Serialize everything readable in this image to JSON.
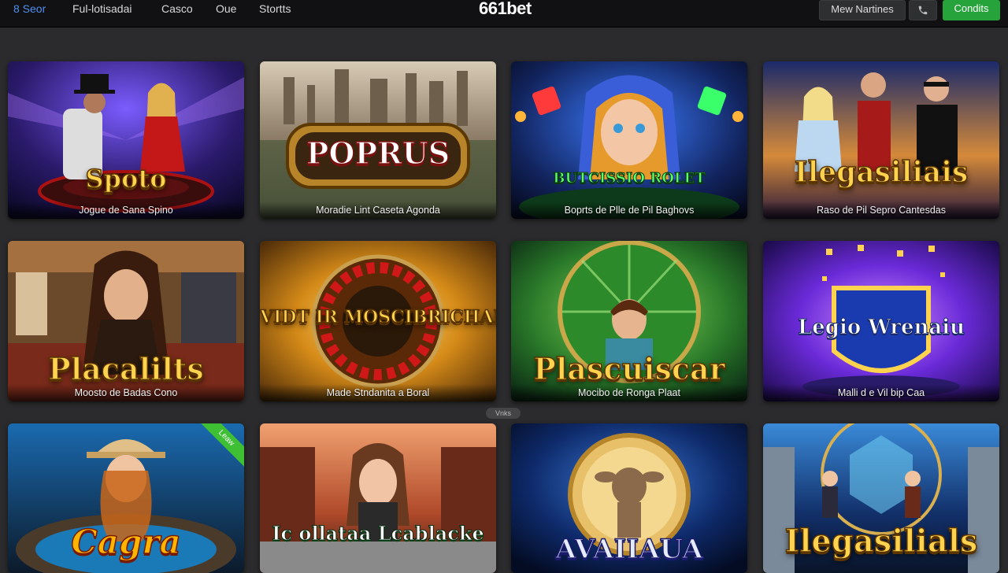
{
  "header": {
    "nav": [
      {
        "label": "8 Seor"
      },
      {
        "label": "Ful-lotisadai"
      },
      {
        "label": "Casco"
      },
      {
        "label": "Oue"
      },
      {
        "label": "Stortts"
      }
    ],
    "logo": "661bet",
    "news_button": "Mew Nartines",
    "phone_icon": "phone-icon",
    "conditions_button": "Condits"
  },
  "games": [
    {
      "title": "Spoto",
      "subtitle": "Jogue de Sana Spino"
    },
    {
      "title": "POPRUS",
      "subtitle": "Moradie Lint Caseta Agonda"
    },
    {
      "title": "BUTCISSIO ROLET",
      "subtitle": "Boprts de Plle de Pil Baghovs"
    },
    {
      "title": "Ilegasiliais",
      "subtitle": "Raso de Pil Sepro Cantesdas"
    },
    {
      "title": "Placalilts",
      "subtitle": "Moosto de Badas Cono"
    },
    {
      "title": "VIDT IR MOSCIBRICHAR",
      "subtitle": "Made Stndanita a Boral"
    },
    {
      "title": "Plascuiscar",
      "subtitle": "Mocibo de Ronga Plaat"
    },
    {
      "title": "Legio Wrenaiu",
      "subtitle": "Malli d e Vil bip Caa"
    },
    {
      "title": "Cagra",
      "subtitle": "",
      "badge": "Leaw"
    },
    {
      "title": "Ic ollataa Lcablacke",
      "subtitle": ""
    },
    {
      "title": "AVAIIAUA",
      "subtitle": ""
    },
    {
      "title": "Ilegasilials",
      "subtitle": ""
    }
  ],
  "pager": "Vnks",
  "colors": {
    "accent": "#4f8ff0",
    "cta": "#27a33b",
    "gold": "#ffd34d"
  }
}
